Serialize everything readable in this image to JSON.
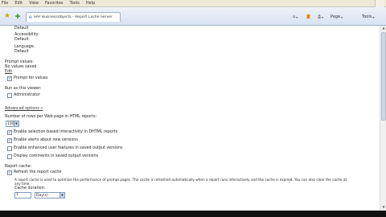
{
  "menu": [
    "File",
    "Edit",
    "View",
    "Favorites",
    "Tools",
    "Help"
  ],
  "tab_title": "SAP BusinessObjects - Report Cache Server",
  "toolbar_right": {
    "page": "Page",
    "tools": "Tools"
  },
  "form": {
    "default_1": "Default",
    "accessibility_label": "Accessibility:",
    "default_2": "Default",
    "language_label": "Language:",
    "default_3": "Default",
    "prompt_values_heading": "Prompt values:",
    "no_values_saved": "No values saved",
    "edit_link": "Edit",
    "prompt_for_values": "Prompt for values",
    "run_as_heading": "Run as this viewer:",
    "administrator": "Administrator",
    "advanced_options_link": "Advanced options »",
    "rows_label": "Number of rows per Web page in HTML reports:",
    "rows_value": "100",
    "opt_1": "Enable selection-based interactivity in DHTML reports",
    "opt_2": "Enable alerts about new versions",
    "opt_3": "Enable enhanced user features in saved output versions",
    "opt_4": "Display comments in saved output versions",
    "report_cache_heading": "Report cache:",
    "refresh_cache": "Refresh the report cache",
    "cache_description_1": "A report cache is used to optimize the performance of prompt pages. The cache is refreshed automatically when a report runs interactively and the cache is expired. You can also clear the cache at",
    "cache_description_2": "any time.",
    "cache_duration_label": "Cache duration:",
    "cache_duration_value": "1",
    "cache_unit": "Day(s)"
  }
}
